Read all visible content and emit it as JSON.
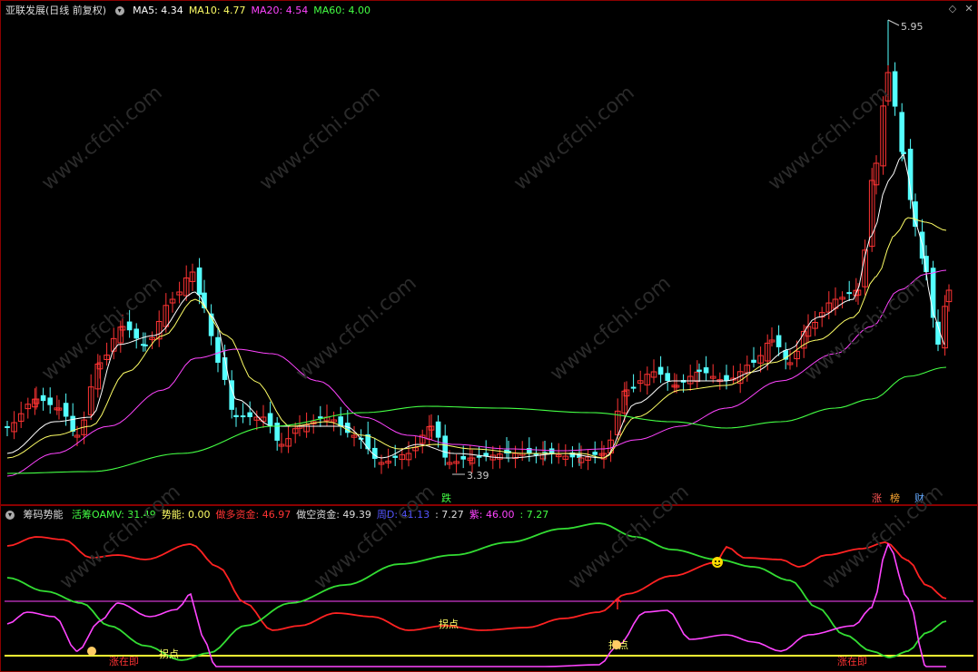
{
  "top": {
    "stock_name": "亚联发展(日线 前复权)",
    "ma": [
      {
        "label": "MA5: 4.34",
        "color": "#ffffff"
      },
      {
        "label": "MA10: 4.77",
        "color": "#ffff66"
      },
      {
        "label": "MA20: 4.54",
        "color": "#ff44ff"
      },
      {
        "label": "MA60: 4.00",
        "color": "#44ff44"
      }
    ],
    "high_label": "5.95",
    "low_label": "3.39",
    "tag_die": "跌",
    "tag_zhang": "涨",
    "tag_bang": "榜",
    "tag_cai": "财"
  },
  "bottom": {
    "indicator_name": "筹码势能",
    "fields": [
      {
        "label": "活筹OAMV: 31.49",
        "color": "#44ff44"
      },
      {
        "label": "势能: 0.00",
        "color": "#ffff66"
      },
      {
        "label": "做多资金: 46.97",
        "color": "#ff3333"
      },
      {
        "label": "做空资金: 49.39",
        "color": "#dddddd"
      },
      {
        "label": "周D: 41.13",
        "color": "#5555ff"
      },
      {
        "label": ": 7.27",
        "color": "#dddddd"
      },
      {
        "label": "紫: 46.00",
        "color": "#ff44ff"
      },
      {
        "label": ": 7.27",
        "color": "#44ff44"
      }
    ],
    "annotations": [
      {
        "text": "拐点",
        "color": "#ffff66"
      },
      {
        "text": "拐点",
        "color": "#ffff66"
      },
      {
        "text": "拐点",
        "color": "#ffff66"
      },
      {
        "text": "涨在即",
        "color": "#ff3333"
      },
      {
        "text": "涨在即",
        "color": "#ff3333"
      }
    ]
  },
  "watermark": "www.cfchi.com",
  "colors": {
    "up": "#ff3333",
    "down": "#54ffff",
    "border": "#8b0000"
  }
}
